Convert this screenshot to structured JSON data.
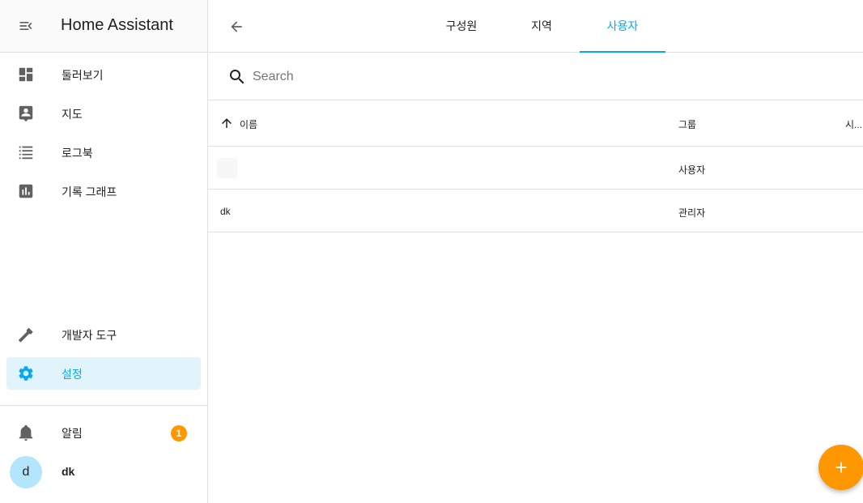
{
  "app": {
    "title": "Home Assistant"
  },
  "sidebar": {
    "items": [
      {
        "label": "둘러보기",
        "icon": "dashboard-icon"
      },
      {
        "label": "지도",
        "icon": "map-account-icon"
      },
      {
        "label": "로그북",
        "icon": "logbook-list-icon"
      },
      {
        "label": "기록 그래프",
        "icon": "history-chart-icon"
      }
    ],
    "tools": [
      {
        "label": "개발자 도구",
        "icon": "hammer-icon"
      },
      {
        "label": "설정",
        "icon": "gear-icon",
        "selected": true
      }
    ],
    "notifications": {
      "label": "알림",
      "count": "1",
      "icon": "bell-icon"
    },
    "user": {
      "initial": "d",
      "name": "dk"
    }
  },
  "tabs": [
    {
      "label": "구성원",
      "active": false
    },
    {
      "label": "지역",
      "active": false
    },
    {
      "label": "사용자",
      "active": true
    }
  ],
  "search": {
    "placeholder": "Search",
    "value": ""
  },
  "table": {
    "columns": [
      "이름",
      "그룹",
      "시..."
    ],
    "rows": [
      {
        "name": "",
        "group": "사용자"
      },
      {
        "name": "dk",
        "group": "관리자"
      }
    ]
  },
  "colors": {
    "accent": "#03a9f4",
    "fab": "#ff9800",
    "selected_bg": "#e1f4fb"
  }
}
